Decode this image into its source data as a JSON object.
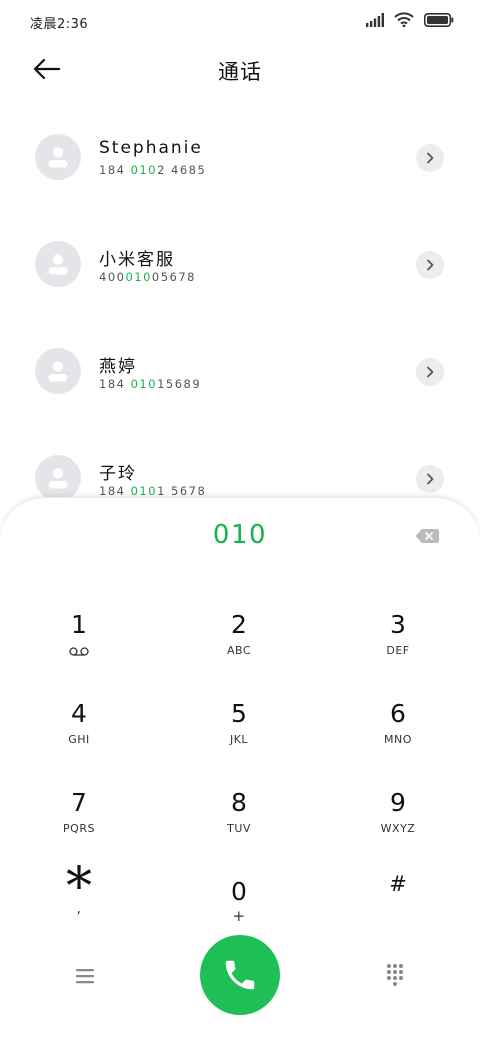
{
  "status_bar": {
    "time": "凌晨2:36"
  },
  "header": {
    "title": "通话"
  },
  "contacts": [
    {
      "name": "Stephanie",
      "number_pre": "184 ",
      "number_match": "010",
      "number_post": "2 4685"
    },
    {
      "name": "小米客服",
      "number_pre": "400",
      "number_match": "010",
      "number_post": "05678"
    },
    {
      "name": "燕婷",
      "number_pre": "184 ",
      "number_match": "010",
      "number_post": "15689"
    },
    {
      "name": "子玲",
      "number_pre": "184 ",
      "number_match": "010",
      "number_post": "1 5678"
    }
  ],
  "dialpad": {
    "entered": "010",
    "keys": [
      {
        "digit": "1",
        "letters": ""
      },
      {
        "digit": "2",
        "letters": "ABC"
      },
      {
        "digit": "3",
        "letters": "DEF"
      },
      {
        "digit": "4",
        "letters": "GHI"
      },
      {
        "digit": "5",
        "letters": "JKL"
      },
      {
        "digit": "6",
        "letters": "MNO"
      },
      {
        "digit": "7",
        "letters": "PQRS"
      },
      {
        "digit": "8",
        "letters": "TUV"
      },
      {
        "digit": "9",
        "letters": "WXYZ"
      },
      {
        "digit": "*",
        "letters": ","
      },
      {
        "digit": "0",
        "letters": "+"
      },
      {
        "digit": "#",
        "letters": ""
      }
    ]
  },
  "icons": {
    "voicemail": "voicemail-icon",
    "call": "phone-icon",
    "menu": "menu-icon",
    "keypad": "keypad-icon"
  },
  "colors": {
    "accent": "#19b14f",
    "call_button": "#1fbf57"
  }
}
